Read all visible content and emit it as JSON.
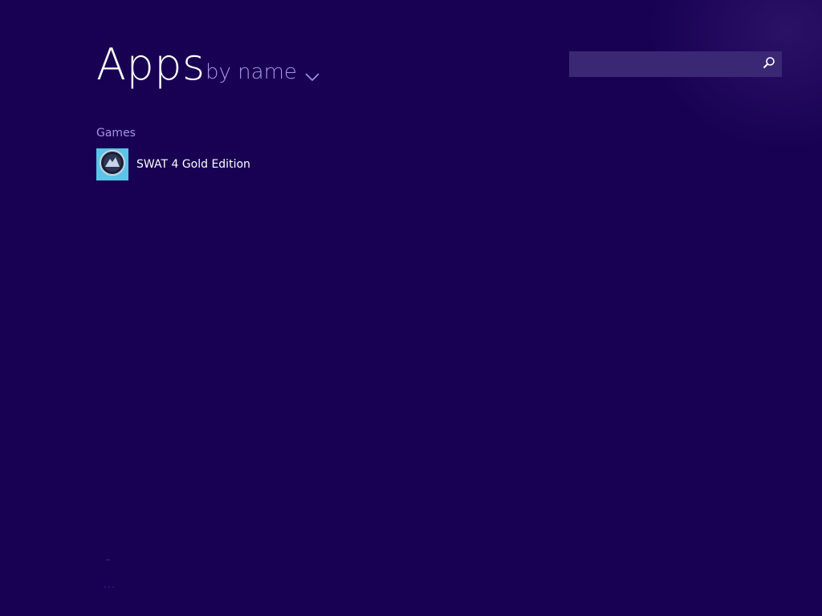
{
  "header": {
    "title": "Apps",
    "sort_label": "by name"
  },
  "search": {
    "value": "",
    "placeholder": ""
  },
  "groups": [
    {
      "label": "Games",
      "apps": [
        {
          "name": "SWAT 4 Gold Edition",
          "icon": "swat4-icon"
        }
      ]
    }
  ],
  "colors": {
    "background": "#180052",
    "accent": "#a596e2",
    "search_box": "#3b2874",
    "tile": "#5bc4e8"
  }
}
